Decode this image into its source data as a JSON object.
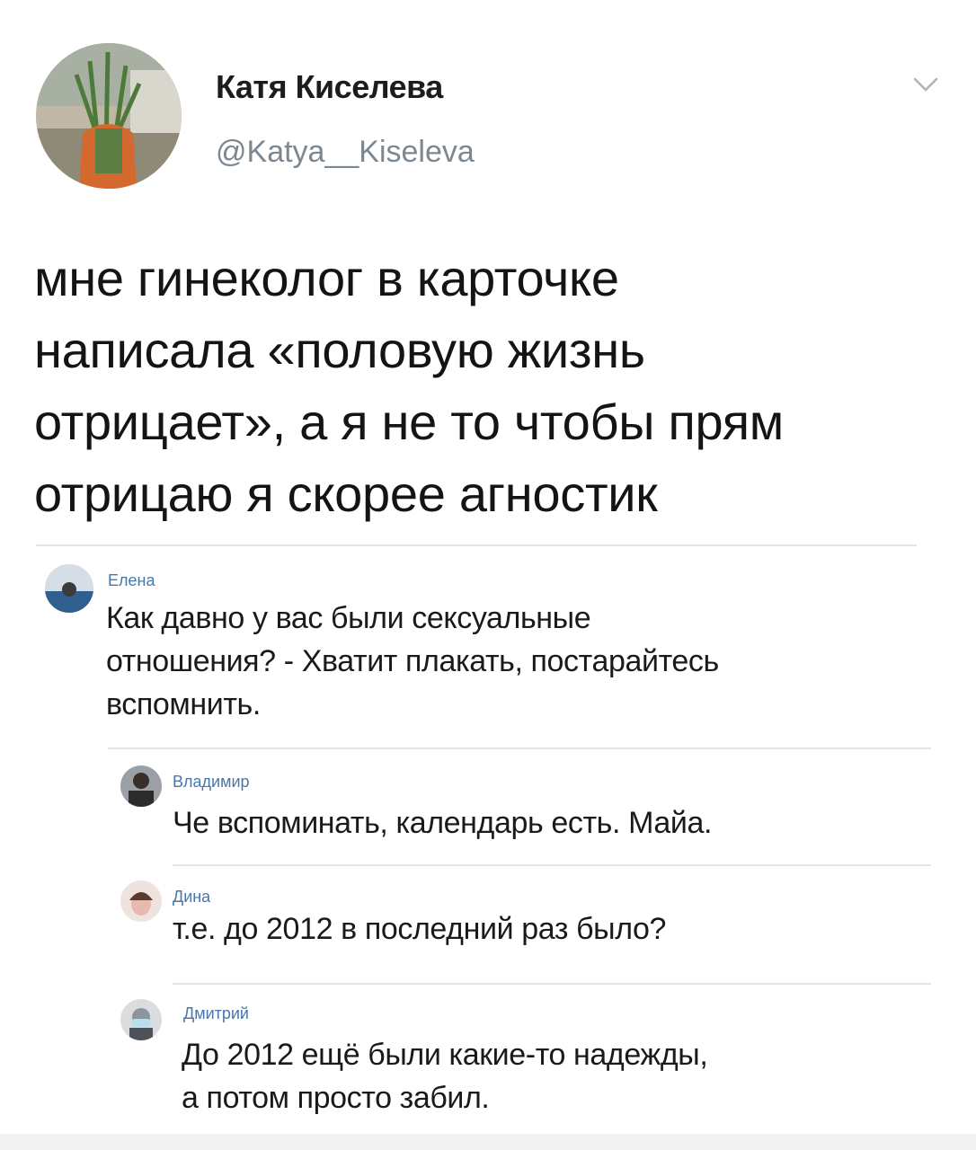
{
  "tweet": {
    "author_name": "Катя Киселева",
    "author_handle": "@Katya__Kiseleva",
    "text_lines": [
      "мне гинеколог в карточке",
      "написала «половую жизнь",
      "отрицает», а я не то чтобы прям",
      "отрицаю я скорее агностик"
    ],
    "menu_icon": "chevron-down-icon"
  },
  "comments": [
    {
      "name": "Елена",
      "text_lines": [
        "Как давно у вас были сексуальные",
        "отношения? - Хватит плакать, постарайтесь",
        "вспомнить."
      ]
    },
    {
      "name": "Владимир",
      "text_lines": [
        "Че вспоминать, календарь есть. Майа."
      ]
    },
    {
      "name": "Дина",
      "text_lines": [
        "т.е. до 2012 в последний раз было?"
      ]
    },
    {
      "name": "Дмитрий",
      "text_lines": [
        "До 2012 ещё были какие-то надежды,",
        "а потом просто забил."
      ]
    }
  ],
  "colors": {
    "link_blue": "#4a76a8",
    "handle_gray": "#7b8791",
    "divider": "#e6e6e6"
  }
}
